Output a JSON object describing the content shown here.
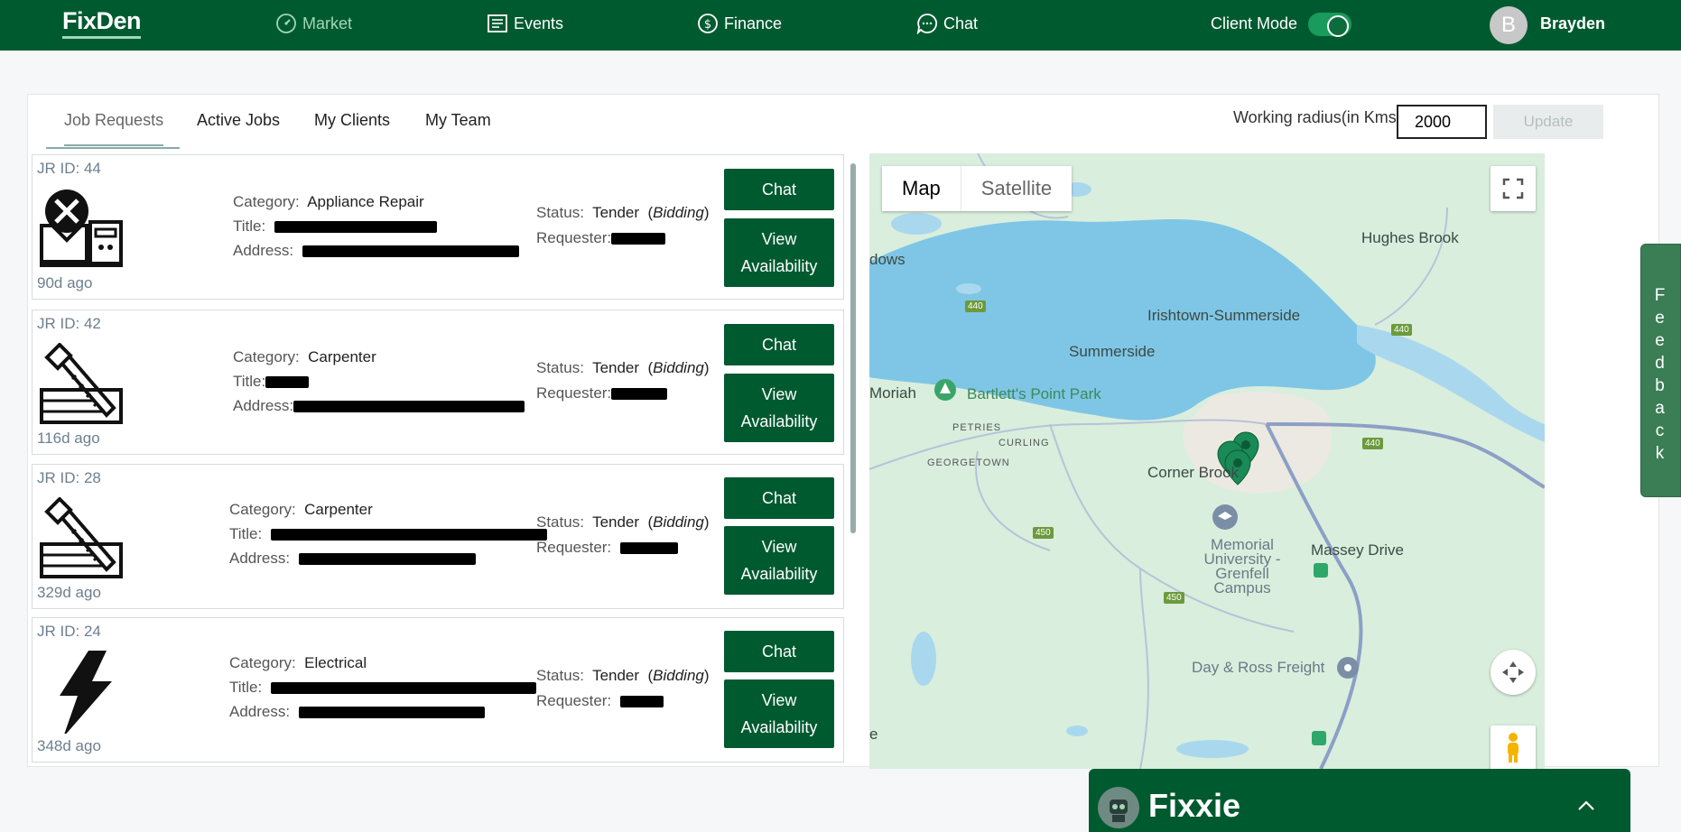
{
  "nav": {
    "brand": "FixDen",
    "items": [
      {
        "label": "Market",
        "icon": "speedometer-icon"
      },
      {
        "label": "Events",
        "icon": "newspaper-icon"
      },
      {
        "label": "Finance",
        "icon": "dollar-circle-icon"
      },
      {
        "label": "Chat",
        "icon": "chat-bubble-icon"
      }
    ],
    "client_mode_label": "Client Mode",
    "avatar_initial": "B",
    "username": "Brayden"
  },
  "tabs": [
    "Job Requests",
    "Active Jobs",
    "My Clients",
    "My Team"
  ],
  "radius": {
    "label": "Working radius(in Kms)",
    "value": "2000",
    "update_label": "Update"
  },
  "labels": {
    "category": "Category:",
    "title": "Title:",
    "address": "Address:",
    "status": "Status:",
    "requester": "Requester:",
    "chat": "Chat",
    "view": "View",
    "availability": "Availability"
  },
  "jobs": [
    {
      "jr_id": "JR ID: 44",
      "age": "90d ago",
      "category": "Appliance Repair",
      "status": "Tender",
      "status_detail": "Bidding",
      "icon": "appliance-repair-icon"
    },
    {
      "jr_id": "JR ID: 42",
      "age": "116d ago",
      "category": "Carpenter",
      "status": "Tender",
      "status_detail": "Bidding",
      "icon": "saw-icon"
    },
    {
      "jr_id": "JR ID: 28",
      "age": "329d ago",
      "category": "Carpenter",
      "status": "Tender",
      "status_detail": "Bidding",
      "icon": "saw-icon"
    },
    {
      "jr_id": "JR ID: 24",
      "age": "348d ago",
      "category": "Electrical",
      "status": "Tender",
      "status_detail": "Bidding",
      "icon": "lightning-icon"
    }
  ],
  "map": {
    "type_map": "Map",
    "type_satellite": "Satellite",
    "labels": {
      "hughes_brook": "Hughes Brook",
      "dows": "dows",
      "irishtown": "Irishtown-Summerside",
      "summerside": "Summerside",
      "moriah": "Moriah",
      "bartletts": "Bartlett's Point Park",
      "petries": "PETRIES",
      "curling": "CURLING",
      "georgetown": "GEORGETOWN",
      "corner_brook": "Corner Brook",
      "massey": "Massey Drive",
      "memorial": "Memorial University - Grenfell Campus",
      "day_ross": "Day & Ross Freight",
      "e": "e"
    },
    "highway_440": "440",
    "highway_450": "450"
  },
  "feedback": "Feedback",
  "fixxie": {
    "title": "Fixxie"
  },
  "colors": {
    "primary": "#005a30",
    "accent": "#9fd8b5",
    "water": "#7fc6e6",
    "land": "#d9eedd"
  }
}
